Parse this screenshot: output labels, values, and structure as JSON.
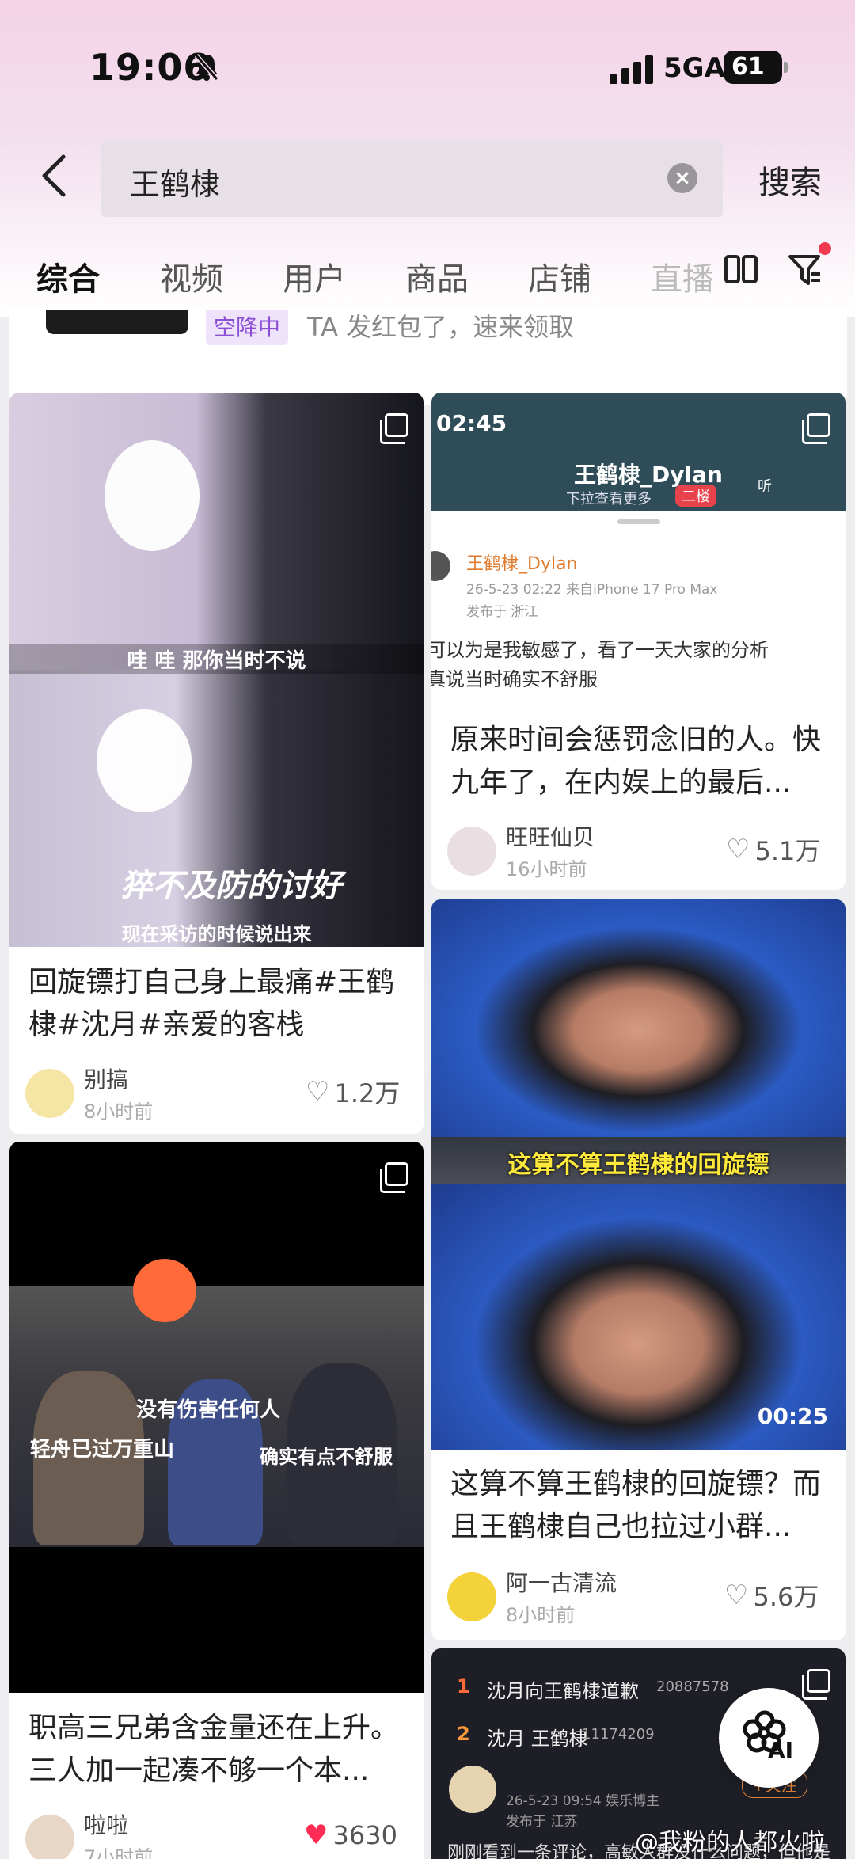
{
  "status_bar": {
    "time": "19:06",
    "network": "5GA",
    "battery": "61"
  },
  "search": {
    "query": "王鹤棣",
    "button": "搜索"
  },
  "tabs": [
    {
      "label": "综合"
    },
    {
      "label": "视频"
    },
    {
      "label": "用户"
    },
    {
      "label": "商品"
    },
    {
      "label": "店铺"
    },
    {
      "label": "直播"
    }
  ],
  "promo": {
    "badge": "空降中",
    "text": "TA 发红包了，速来领取"
  },
  "cards": [
    {
      "title": "回旋镖打自己身上最痛#王鹤棣#沈月#亲爱的客栈",
      "author": "别搞",
      "time": "8小时前",
      "likes": "1.2万",
      "image_captions": [
        "哇 哇 那你当时不说",
        "猝不及防的讨好",
        "现在采访的时候说出来"
      ]
    },
    {
      "title": "原来时间会惩罚念旧的人。快九年了，在内娱上的最后...",
      "author": "旺旺仙贝",
      "time": "16小时前",
      "likes": "5.1万",
      "screenshot": {
        "time": "02:45",
        "profile": "王鹤棣_Dylan",
        "pull_hint": "下拉查看更多",
        "floor": "二楼",
        "listen": "听",
        "post_user": "王鹤棣_Dylan",
        "post_meta": "26-5-23 02:22  来自iPhone 17 Pro Max",
        "post_loc": "发布于 浙江",
        "post_line1": "可以为是我敏感了，看了一天大家的分析",
        "post_line2": "真说当时确实不舒服"
      }
    },
    {
      "title": "这算不算王鹤棣的回旋镖？而且王鹤棣自己也拉过小群...",
      "author": "阿一古清流",
      "time": "8小时前",
      "likes": "5.6万",
      "image_caption": "这算不算王鹤棣的回旋镖",
      "duration": "00:25"
    },
    {
      "title": "职高三兄弟含金量还在上升。三人加一起凑不够一个本...",
      "author": "啦啦",
      "time": "7小时前",
      "likes": "3630",
      "image_captions": [
        "没有伤害任何人",
        "轻舟已过万重山",
        "确实有点不舒服"
      ]
    },
    {
      "hot_list": [
        {
          "rank": "1",
          "text": "沈月向王鹤棣道歉",
          "count": "20887578"
        },
        {
          "rank": "2",
          "text": "沈月 王鹤棣",
          "count": "11174209"
        }
      ],
      "post_meta": "26-5-23 09:54  娱乐博主",
      "post_loc": "发布于 江苏",
      "follow": "+关注",
      "snippet": "刚刚看到一条评论，高敏人群没什么问题，但他是"
    }
  ],
  "ai_button": "AI",
  "watermark": "@我粉的人都火啦"
}
